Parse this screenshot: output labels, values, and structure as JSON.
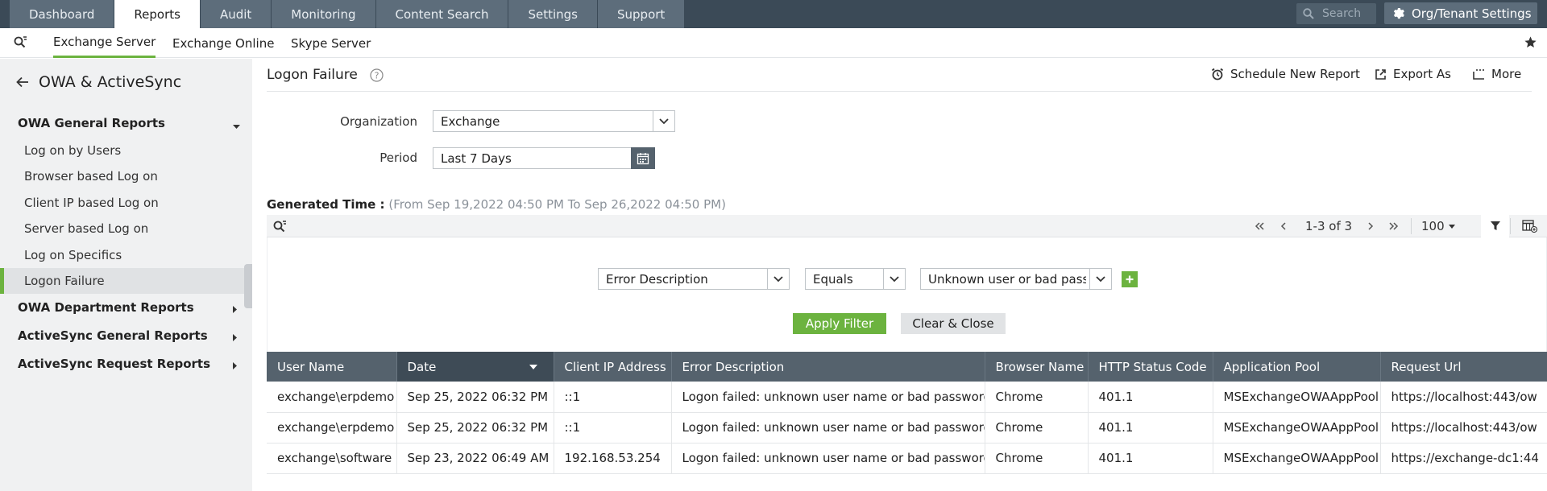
{
  "top_nav": {
    "tabs": [
      {
        "label": "Dashboard",
        "active": false
      },
      {
        "label": "Reports",
        "active": true
      },
      {
        "label": "Audit",
        "active": false
      },
      {
        "label": "Monitoring",
        "active": false
      },
      {
        "label": "Content Search",
        "active": false
      },
      {
        "label": "Settings",
        "active": false
      },
      {
        "label": "Support",
        "active": false
      }
    ],
    "search_placeholder": "Search",
    "org_settings_label": "Org/Tenant Settings"
  },
  "sub_nav": {
    "tabs": [
      {
        "label": "Exchange Server",
        "active": true
      },
      {
        "label": "Exchange Online",
        "active": false
      },
      {
        "label": "Skype Server",
        "active": false
      }
    ]
  },
  "sidebar": {
    "title": "OWA & ActiveSync",
    "groups": [
      {
        "label": "OWA General Reports",
        "expanded": true
      },
      {
        "label": "OWA Department Reports",
        "expanded": false
      },
      {
        "label": "ActiveSync General Reports",
        "expanded": false
      },
      {
        "label": "ActiveSync Request Reports",
        "expanded": false
      }
    ],
    "items": [
      {
        "label": "Log on by Users",
        "active": false
      },
      {
        "label": "Browser based Log on",
        "active": false
      },
      {
        "label": "Client IP based Log on",
        "active": false
      },
      {
        "label": "Server based Log on",
        "active": false
      },
      {
        "label": "Log on Specifics",
        "active": false
      },
      {
        "label": "Logon Failure",
        "active": true
      }
    ]
  },
  "report": {
    "title": "Logon Failure",
    "actions": {
      "schedule": "Schedule New Report",
      "export": "Export As",
      "more": "More"
    },
    "form": {
      "organization_label": "Organization",
      "organization_value": "Exchange",
      "period_label": "Period",
      "period_value": "Last 7 Days"
    },
    "generated_time_label": "Generated Time :",
    "generated_time_range": "(From Sep 19,2022 04:50 PM To Sep 26,2022 04:50 PM)"
  },
  "grid_toolbar": {
    "page_info": "1-3 of 3",
    "page_size": "100"
  },
  "filter": {
    "field": "Error Description",
    "operator": "Equals",
    "value": "Unknown user or bad passw",
    "apply_label": "Apply Filter",
    "clear_label": "Clear & Close"
  },
  "table": {
    "columns": [
      "User Name",
      "Date",
      "Client IP Address",
      "Error Description",
      "Browser Name",
      "HTTP Status Code",
      "Application Pool",
      "Request Url"
    ],
    "sorted_column": "Date",
    "rows": [
      [
        "exchange\\erpdemo",
        "Sep 25, 2022 06:32 PM",
        "::1",
        "Logon failed: unknown user name or bad password",
        "Chrome",
        "401.1",
        "MSExchangeOWAAppPool",
        "https://localhost:443/ow"
      ],
      [
        "exchange\\erpdemo",
        "Sep 25, 2022 06:32 PM",
        "::1",
        "Logon failed: unknown user name or bad password",
        "Chrome",
        "401.1",
        "MSExchangeOWAAppPool",
        "https://localhost:443/ow"
      ],
      [
        "exchange\\software",
        "Sep 23, 2022 06:49 AM",
        "192.168.53.254",
        "Logon failed: unknown user name or bad password",
        "Chrome",
        "401.1",
        "MSExchangeOWAAppPool",
        "https://exchange-dc1:44"
      ]
    ]
  },
  "colors": {
    "nav_dark": "#3b4a57",
    "nav_tab": "#5d6d7b",
    "accent_green": "#6cb33f",
    "table_header": "#55626d"
  }
}
